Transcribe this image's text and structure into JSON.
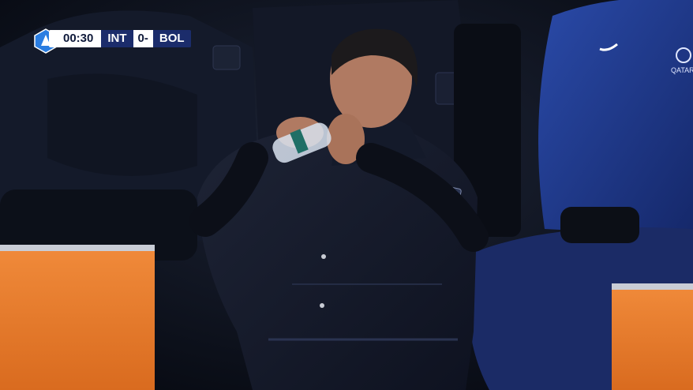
{
  "scorebug": {
    "clock": "00:30",
    "home_team": "INT",
    "score": "0-0",
    "away_team": "BOL",
    "accent_color": "#1b2c6b",
    "league_icon": "serie-a-logo-icon"
  },
  "background": {
    "ad_board_color": "#e07a2c",
    "jacket_brand": "QATAR AIRWAYS"
  }
}
